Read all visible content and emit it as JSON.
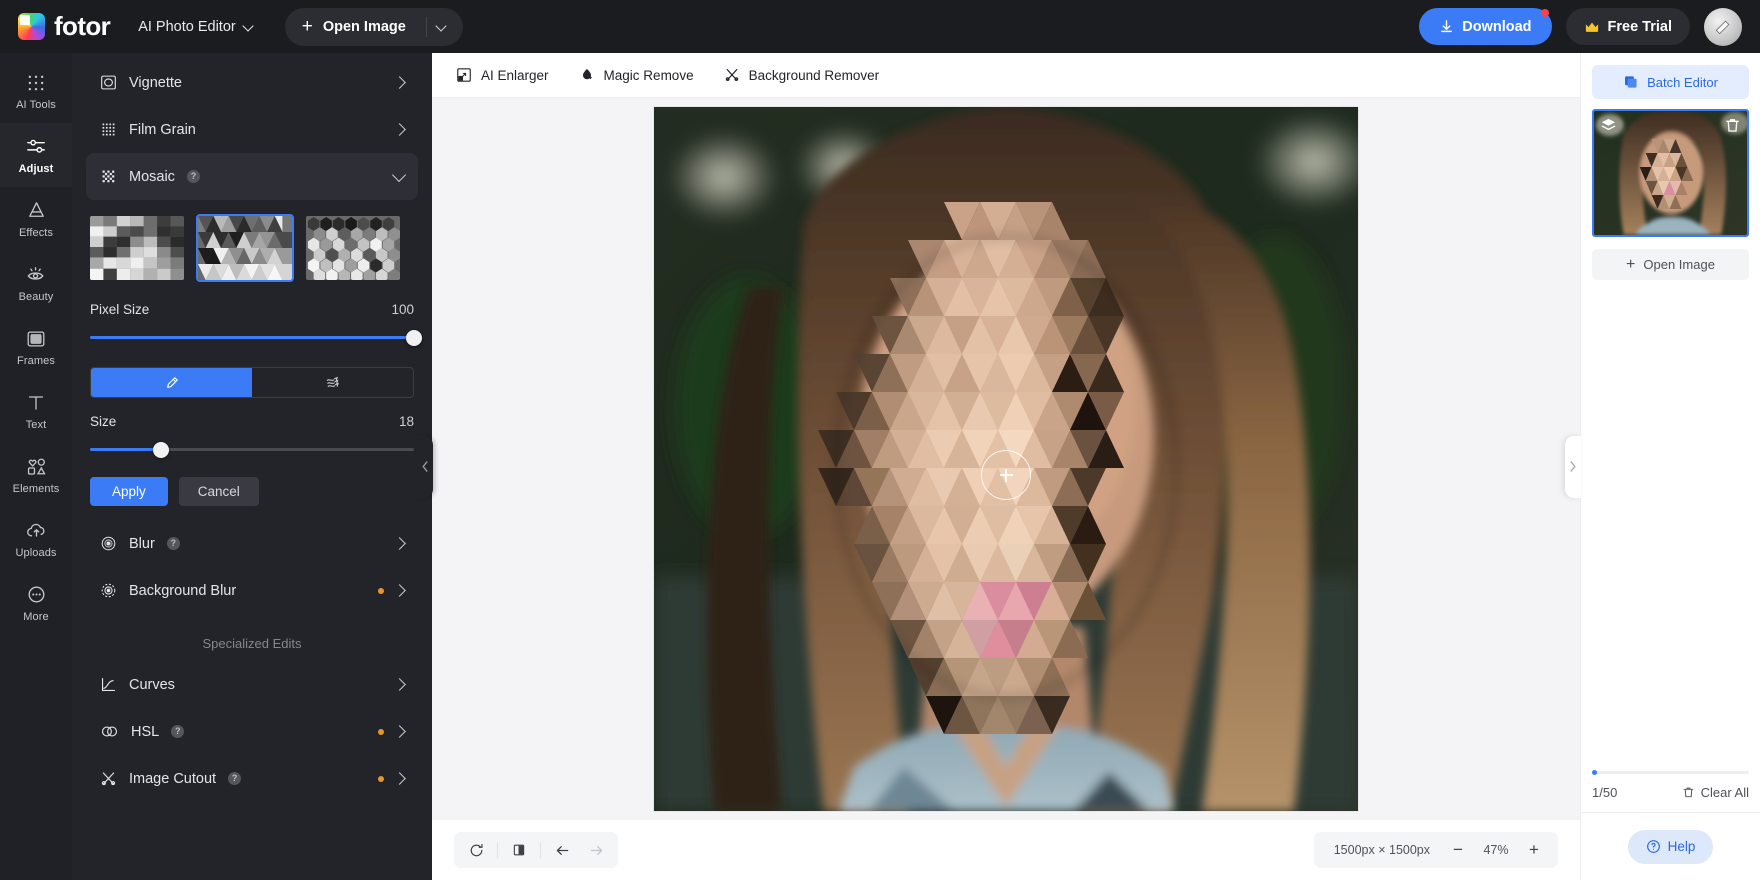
{
  "header": {
    "brand": "fotor",
    "mode_label": "AI Photo Editor",
    "open_image_label": "Open Image",
    "download_label": "Download",
    "free_trial_label": "Free Trial",
    "accent_blue": "#3b7cf6",
    "badge_red": "#f4434f"
  },
  "rail": {
    "items": [
      {
        "label": "AI Tools",
        "icon": "grid-dots-icon",
        "active": false
      },
      {
        "label": "Adjust",
        "icon": "sliders-icon",
        "active": true
      },
      {
        "label": "Effects",
        "icon": "effects-icon",
        "active": false
      },
      {
        "label": "Beauty",
        "icon": "eye-icon",
        "active": false
      },
      {
        "label": "Frames",
        "icon": "frame-icon",
        "active": false
      },
      {
        "label": "Text",
        "icon": "text-t-icon",
        "active": false
      },
      {
        "label": "Elements",
        "icon": "shapes-icon",
        "active": false
      },
      {
        "label": "Uploads",
        "icon": "cloud-upload-icon",
        "active": false
      },
      {
        "label": "More",
        "icon": "ellipsis-circle-icon",
        "active": false
      }
    ]
  },
  "panel": {
    "rows_top": [
      {
        "label": "Vignette",
        "icon": "vignette-icon",
        "help": false,
        "dot": false
      },
      {
        "label": "Film Grain",
        "icon": "film-grain-icon",
        "help": false,
        "dot": false
      }
    ],
    "mosaic": {
      "label": "Mosaic",
      "icon": "mosaic-icon",
      "help": true,
      "expanded": true,
      "styles": [
        {
          "name": "square-mosaic",
          "selected": false
        },
        {
          "name": "triangle-mosaic",
          "selected": true
        },
        {
          "name": "hexagon-mosaic",
          "selected": false
        }
      ],
      "pixel_size": {
        "label": "Pixel Size",
        "value": "100",
        "percent": 100
      },
      "tools": [
        {
          "name": "brush-tool",
          "active": true
        },
        {
          "name": "eraser-tool",
          "active": false
        }
      ],
      "size": {
        "label": "Size",
        "value": "18",
        "percent": 22
      },
      "apply_label": "Apply",
      "cancel_label": "Cancel"
    },
    "rows_mid": [
      {
        "label": "Blur",
        "icon": "blur-icon",
        "help": true,
        "dot": false
      },
      {
        "label": "Background Blur",
        "icon": "background-blur-icon",
        "help": false,
        "dot": true
      }
    ],
    "section_label": "Specialized Edits",
    "rows_bottom": [
      {
        "label": "Curves",
        "icon": "curves-icon",
        "help": false,
        "dot": false
      },
      {
        "label": "HSL",
        "icon": "hsl-icon",
        "help": true,
        "dot": true
      },
      {
        "label": "Image Cutout",
        "icon": "image-cutout-icon",
        "help": true,
        "dot": true
      }
    ]
  },
  "canvas": {
    "tools": [
      {
        "label": "AI Enlarger",
        "icon": "ai-enlarger-icon"
      },
      {
        "label": "Magic Remove",
        "icon": "magic-remove-icon"
      },
      {
        "label": "Background Remover",
        "icon": "background-remover-icon"
      }
    ],
    "bottom_left_buttons": [
      {
        "name": "reset-history-icon"
      },
      {
        "name": "compare-icon"
      },
      {
        "name": "undo-arrow-icon"
      },
      {
        "name": "redo-arrow-icon"
      }
    ],
    "dimensions": "1500px × 1500px",
    "zoom_level": "47%",
    "zoom_out_label": "−",
    "zoom_in_label": "+",
    "collapse_left_icon": "chevron-left-icon",
    "collapse_right_icon": "chevron-right-icon"
  },
  "right_panel": {
    "batch_editor_label": "Batch Editor",
    "thumb_icons": [
      {
        "name": "layers-icon"
      },
      {
        "name": "trash-icon"
      }
    ],
    "open_image_label": "Open Image",
    "count_label": "1/50",
    "clear_all_label": "Clear All",
    "help_label": "Help"
  }
}
